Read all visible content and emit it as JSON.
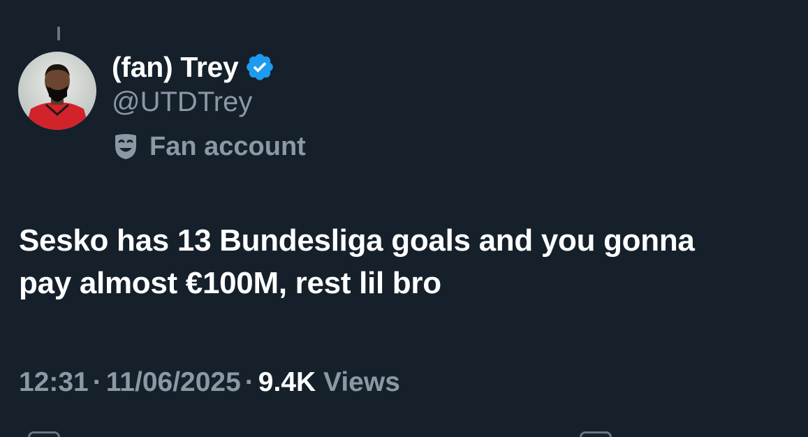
{
  "tweet": {
    "author": {
      "display_name": "(fan) Trey",
      "handle": "@UTDTrey",
      "verified": true,
      "account_label": "Fan account"
    },
    "text_line1": "Sesko has 13 Bundesliga goals and you gonna",
    "text_line2": "pay almost €100M, rest lil bro",
    "time": "12:31",
    "date": "11/06/2025",
    "views_count": "9.4K",
    "views_label": "Views"
  },
  "colors": {
    "background": "#15202b",
    "verified_badge": "#1d9bf0",
    "secondary_text": "#8b98a5"
  },
  "icons": {
    "verified": "verified-badge-icon",
    "label": "theater-mask-icon"
  }
}
